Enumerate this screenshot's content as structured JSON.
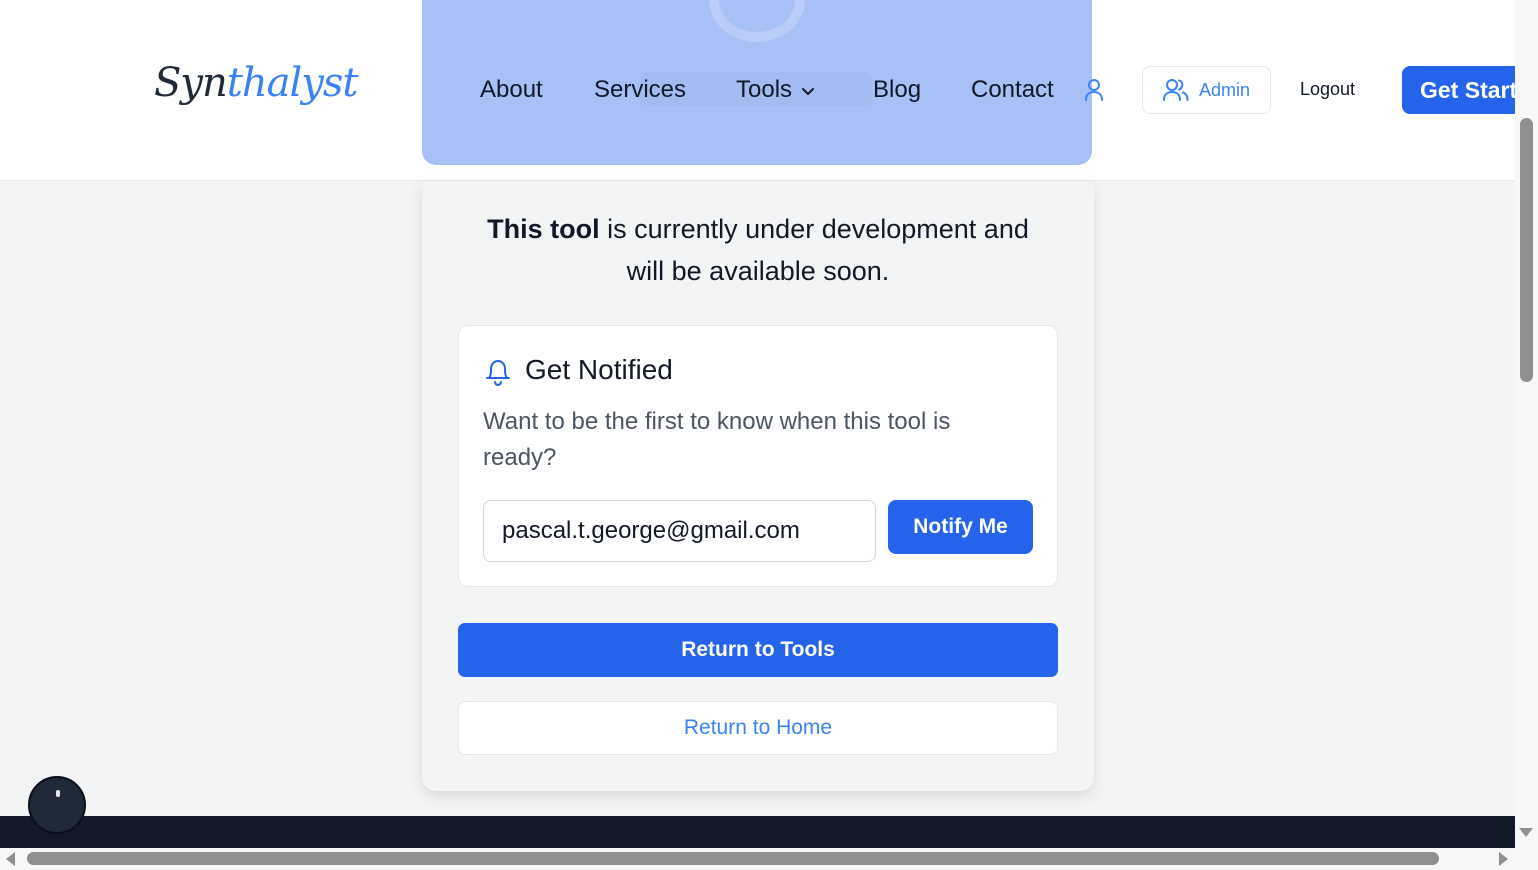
{
  "brand": {
    "logo_part1": "Syn",
    "logo_part2": "thalyst"
  },
  "nav": {
    "about": "About",
    "services": "Services",
    "tools": "Tools",
    "blog": "Blog",
    "contact": "Contact",
    "admin": "Admin",
    "logout": "Logout",
    "get_started": "Get Started"
  },
  "main": {
    "desc_bold": "This tool",
    "desc_rest_line1": " is currently under development and",
    "desc_line2": "will be available soon."
  },
  "notify": {
    "title": "Get Notified",
    "text": "Want to be the first to know when this tool is ready?",
    "email_value": "pascal.t.george@gmail.com",
    "button": "Notify Me"
  },
  "actions": {
    "return_tools": "Return to Tools",
    "return_home": "Return to Home"
  },
  "colors": {
    "primary": "#2563eb",
    "link": "#3b82f6",
    "hero": "#a7c0f6",
    "footer": "#111827"
  }
}
